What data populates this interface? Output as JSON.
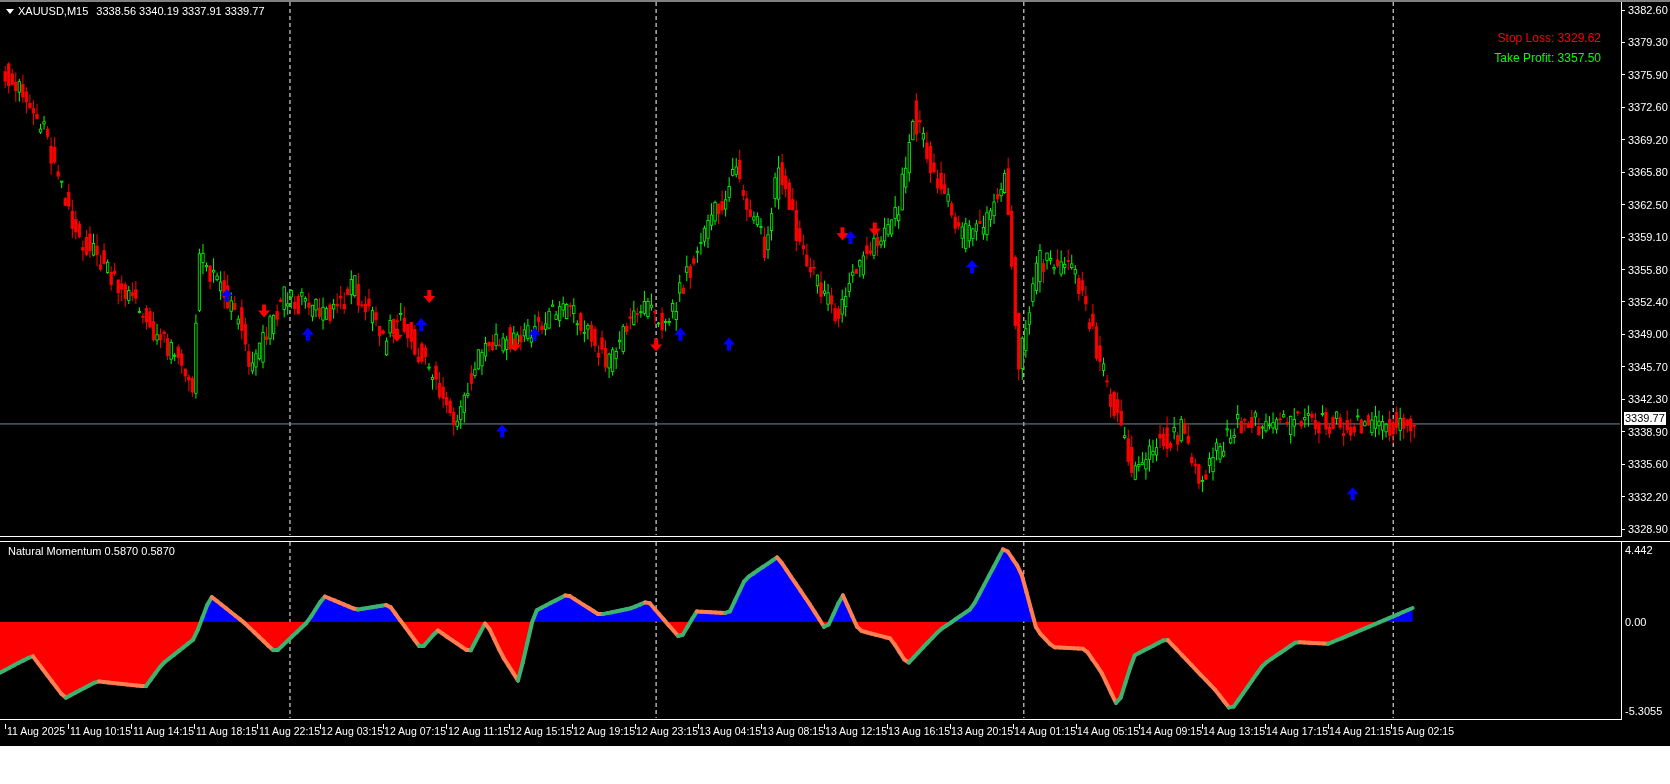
{
  "chart": {
    "header": {
      "symbol": "XAUUSD,M15",
      "ohlc": "3338.56 3340.19 3337.91 3339.77"
    },
    "stop_loss": "Stop Loss: 3329.62",
    "take_profit": "Take Profit: 3357.50",
    "price_axis": [
      "3382.60",
      "3379.30",
      "3375.90",
      "3372.60",
      "3369.20",
      "3365.80",
      "3362.50",
      "3359.10",
      "3355.80",
      "3352.40",
      "3349.00",
      "3345.70",
      "3342.30",
      "3338.90",
      "3335.60",
      "3332.20",
      "3328.90"
    ],
    "current_price": "3339.77"
  },
  "indicator": {
    "title": "Natural Momentum 0.5870 0.5870",
    "axis": [
      "4.442",
      "0.00",
      "-5.3055"
    ]
  },
  "time_axis": [
    "11 Aug 2025",
    "11 Aug 10:15",
    "11 Aug 14:15",
    "11 Aug 18:15",
    "11 Aug 22:15",
    "12 Aug 03:15",
    "12 Aug 07:15",
    "12 Aug 11:15",
    "12 Aug 15:15",
    "12 Aug 19:15",
    "12 Aug 23:15",
    "13 Aug 04:15",
    "13 Aug 08:15",
    "13 Aug 12:15",
    "13 Aug 16:15",
    "13 Aug 20:15",
    "14 Aug 01:15",
    "14 Aug 05:15",
    "14 Aug 09:15",
    "14 Aug 13:15",
    "14 Aug 17:15",
    "14 Aug 21:15",
    "15 Aug 02:15"
  ]
}
